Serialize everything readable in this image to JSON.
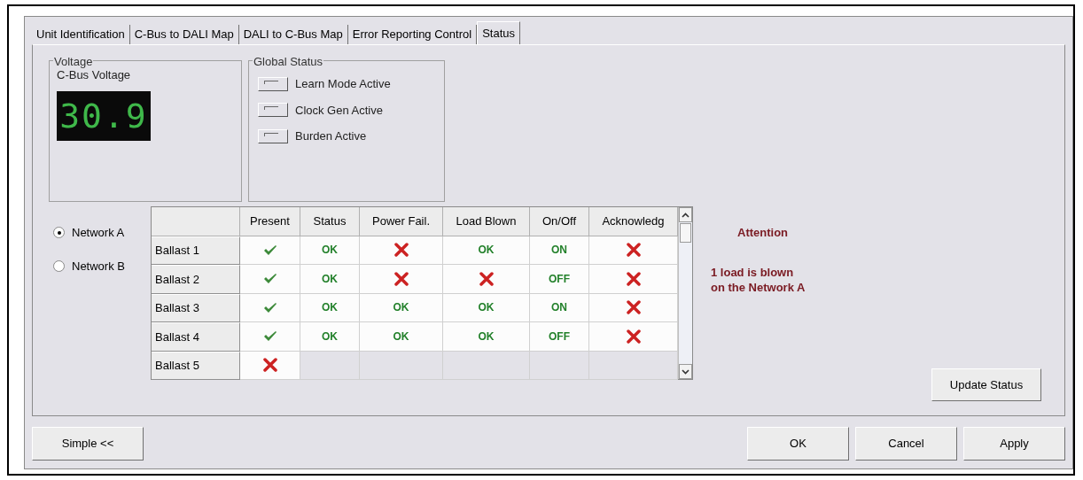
{
  "tabs": [
    {
      "label": "Unit Identification",
      "selected": false
    },
    {
      "label": "C-Bus to DALI Map",
      "selected": false
    },
    {
      "label": "DALI to C-Bus Map",
      "selected": false
    },
    {
      "label": "Error Reporting Control",
      "selected": false
    },
    {
      "label": "Status",
      "selected": true
    }
  ],
  "voltage": {
    "group_title": "Voltage",
    "label": "C-Bus Voltage",
    "reading": "30.9"
  },
  "global_status": {
    "group_title": "Global Status",
    "items": [
      {
        "label": "Learn Mode Active",
        "on": false
      },
      {
        "label": "Clock Gen Active",
        "on": false
      },
      {
        "label": "Burden Active",
        "on": false
      }
    ]
  },
  "networks": [
    {
      "label": "Network A",
      "selected": true
    },
    {
      "label": "Network B",
      "selected": false
    }
  ],
  "table": {
    "columns": [
      "Present",
      "Status",
      "Power Fail.",
      "Load Blown",
      "On/Off",
      "Acknowledg"
    ],
    "rows": [
      {
        "name": "Ballast 1",
        "cells": [
          {
            "kind": "check"
          },
          {
            "kind": "text",
            "text": "OK"
          },
          {
            "kind": "cross"
          },
          {
            "kind": "text",
            "text": "OK"
          },
          {
            "kind": "text",
            "text": "ON"
          },
          {
            "kind": "cross"
          }
        ]
      },
      {
        "name": "Ballast 2",
        "cells": [
          {
            "kind": "check"
          },
          {
            "kind": "text",
            "text": "OK"
          },
          {
            "kind": "cross"
          },
          {
            "kind": "cross"
          },
          {
            "kind": "text",
            "text": "OFF"
          },
          {
            "kind": "cross"
          }
        ]
      },
      {
        "name": "Ballast 3",
        "cells": [
          {
            "kind": "check"
          },
          {
            "kind": "text",
            "text": "OK"
          },
          {
            "kind": "text",
            "text": "OK"
          },
          {
            "kind": "text",
            "text": "OK"
          },
          {
            "kind": "text",
            "text": "ON"
          },
          {
            "kind": "cross"
          }
        ]
      },
      {
        "name": "Ballast 4",
        "cells": [
          {
            "kind": "check"
          },
          {
            "kind": "text",
            "text": "OK"
          },
          {
            "kind": "text",
            "text": "OK"
          },
          {
            "kind": "text",
            "text": "OK"
          },
          {
            "kind": "text",
            "text": "OFF"
          },
          {
            "kind": "cross"
          }
        ]
      },
      {
        "name": "Ballast 5",
        "cells": [
          {
            "kind": "cross"
          },
          {
            "kind": "empty"
          },
          {
            "kind": "empty"
          },
          {
            "kind": "empty"
          },
          {
            "kind": "empty"
          },
          {
            "kind": "empty"
          }
        ]
      }
    ]
  },
  "attention": {
    "title": "Attention",
    "message": "1 load is blown\non the Network A"
  },
  "update_button": "Update Status",
  "buttons": {
    "left": "Simple <<",
    "right": [
      "OK",
      "Cancel",
      "Apply"
    ]
  }
}
